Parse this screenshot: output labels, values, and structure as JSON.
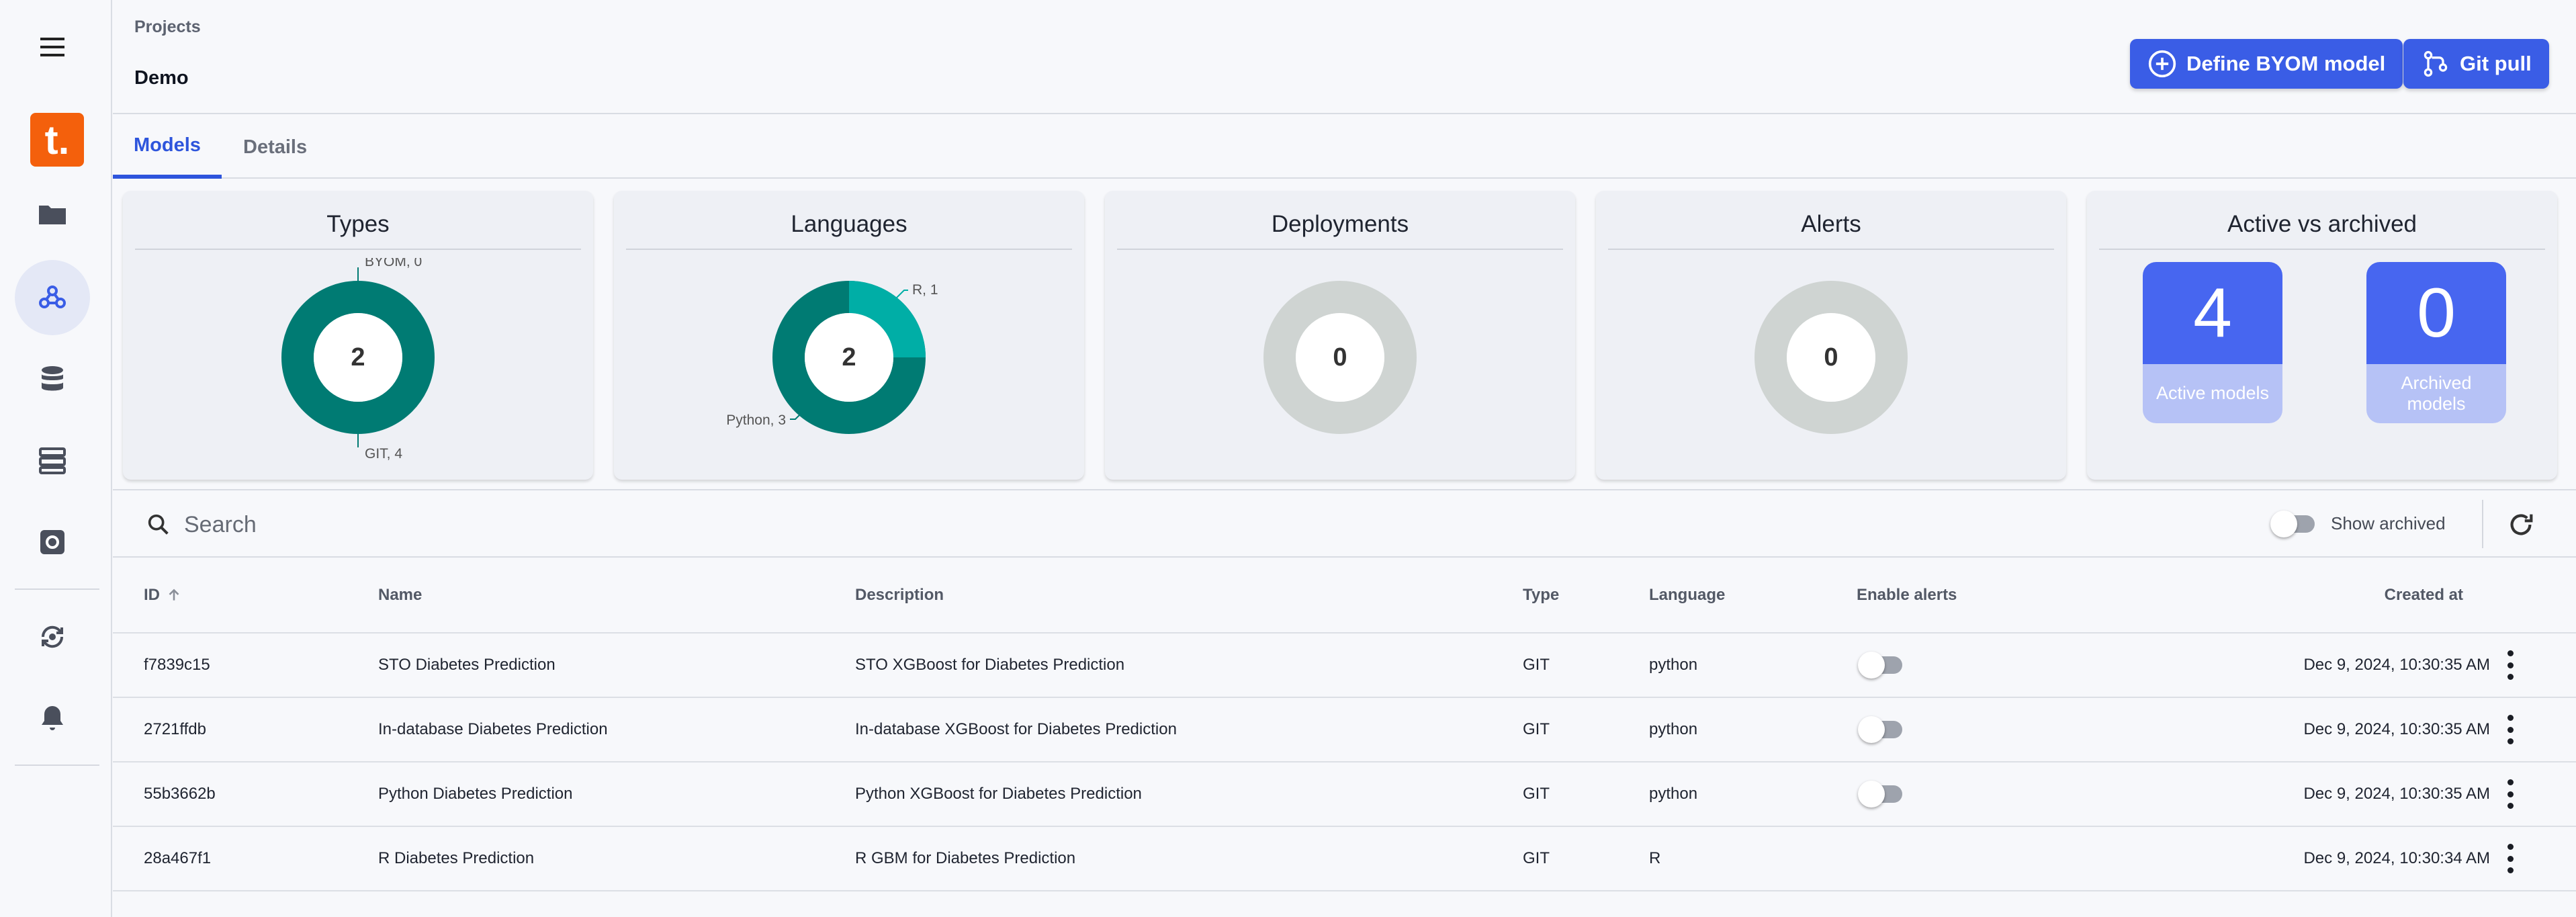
{
  "header": {
    "breadcrumb": "Projects",
    "project_name": "Demo",
    "define_byom_label": "Define BYOM model",
    "git_pull_label": "Git pull"
  },
  "tabs": [
    {
      "label": "Models",
      "active": true
    },
    {
      "label": "Details",
      "active": false
    }
  ],
  "cards": {
    "types": {
      "title": "Types",
      "total": "2",
      "labels": [
        "BYOM, 0",
        "GIT, 4"
      ]
    },
    "languages": {
      "title": "Languages",
      "total": "2",
      "labels": [
        "R, 1",
        "Python, 3"
      ]
    },
    "deployments": {
      "title": "Deployments",
      "total": "0"
    },
    "alerts": {
      "title": "Alerts",
      "total": "0"
    },
    "active_archived": {
      "title": "Active vs archived",
      "active_count": "4",
      "active_label": "Active models",
      "archived_count": "0",
      "archived_label": "Archived models"
    }
  },
  "chart_data": [
    {
      "type": "pie",
      "title": "Types",
      "categories": [
        "BYOM",
        "GIT"
      ],
      "values": [
        0,
        4
      ],
      "center_label": "2"
    },
    {
      "type": "pie",
      "title": "Languages",
      "categories": [
        "R",
        "Python"
      ],
      "values": [
        1,
        3
      ],
      "center_label": "2"
    },
    {
      "type": "pie",
      "title": "Deployments",
      "categories": [],
      "values": [],
      "center_label": "0"
    },
    {
      "type": "pie",
      "title": "Alerts",
      "categories": [],
      "values": [],
      "center_label": "0"
    }
  ],
  "search": {
    "placeholder": "Search",
    "show_archived_label": "Show archived"
  },
  "table": {
    "columns": [
      "ID",
      "Name",
      "Description",
      "Type",
      "Language",
      "Enable alerts",
      "Created at"
    ],
    "rows": [
      {
        "id": "f7839c15",
        "name": "STO Diabetes Prediction",
        "description": "STO XGBoost for Diabetes Prediction",
        "type": "GIT",
        "language": "python",
        "alerts_toggle": true,
        "created": "Dec 9, 2024, 10:30:35 AM"
      },
      {
        "id": "2721ffdb",
        "name": "In-database Diabetes Prediction",
        "description": "In-database XGBoost for Diabetes Prediction",
        "type": "GIT",
        "language": "python",
        "alerts_toggle": true,
        "created": "Dec 9, 2024, 10:30:35 AM"
      },
      {
        "id": "55b3662b",
        "name": "Python Diabetes Prediction",
        "description": "Python XGBoost for Diabetes Prediction",
        "type": "GIT",
        "language": "python",
        "alerts_toggle": true,
        "created": "Dec 9, 2024, 10:30:35 AM"
      },
      {
        "id": "28a467f1",
        "name": "R Diabetes Prediction",
        "description": "R GBM for Diabetes Prediction",
        "type": "GIT",
        "language": "R",
        "alerts_toggle": false,
        "created": "Dec 9, 2024, 10:30:34 AM"
      }
    ]
  },
  "colors": {
    "primary": "#3a5de6",
    "teal_dark": "#007b73",
    "teal_light": "#00aea6",
    "empty_ring": "#cfd4d2",
    "logo": "#f4600c"
  },
  "icons": [
    "menu-icon",
    "folder-icon",
    "models-icon",
    "database-icon",
    "server-icon",
    "settings-icon",
    "sync-icon",
    "bell-icon",
    "plus-circle-icon",
    "git-icon",
    "search-icon",
    "refresh-icon",
    "kebab-icon",
    "sort-up-icon"
  ]
}
